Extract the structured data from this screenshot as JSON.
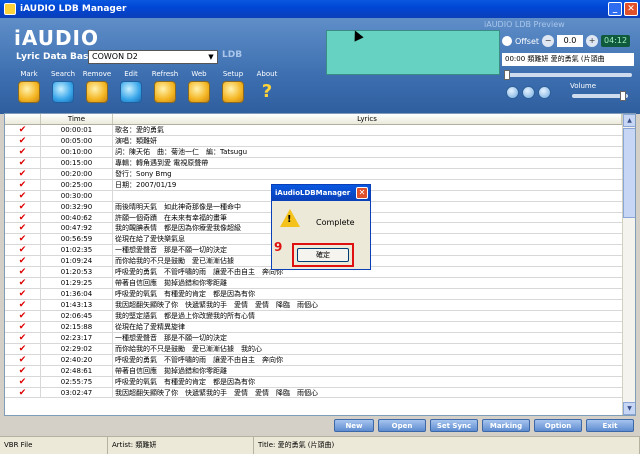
{
  "window": {
    "title": "iAUDIO LDB Manager"
  },
  "brand": {
    "logo": "iAUDIO",
    "subtitle": "Lyric Data Base",
    "ldb_mark": "LDB"
  },
  "device": {
    "selected": "COWON D2"
  },
  "toolbar": [
    {
      "label": "Mark",
      "icon": "mark-icon"
    },
    {
      "label": "Search",
      "icon": "search-icon"
    },
    {
      "label": "Remove",
      "icon": "remove-icon"
    },
    {
      "label": "Edit",
      "icon": "edit-icon"
    },
    {
      "label": "Refresh",
      "icon": "refresh-icon"
    },
    {
      "label": "Web",
      "icon": "web-icon"
    },
    {
      "label": "Setup",
      "icon": "setup-icon"
    },
    {
      "label": "About",
      "icon": "help-icon"
    }
  ],
  "preview": {
    "title": "iAUDIO LDB Preview",
    "offset_label": "Offset",
    "offset_value": "0.0",
    "time": "04:12",
    "song": "00:00 類難妍 愛的勇氣 (片頭曲"
  },
  "volume": {
    "label": "Volume"
  },
  "table": {
    "headers": [
      "",
      "Time",
      "Lyrics"
    ],
    "rows": [
      {
        "mark": "✔",
        "time": "00:00:01",
        "lyric": "歌名：愛的勇氣"
      },
      {
        "mark": "✔",
        "time": "00:05:00",
        "lyric": "演唱：類難妍"
      },
      {
        "mark": "✔",
        "time": "00:10:00",
        "lyric": "詞：陳天佑　曲：菊池一仁　編：Tatsugu"
      },
      {
        "mark": "✔",
        "time": "00:15:00",
        "lyric": "專輯：轉角遇到愛 電視原聲帶"
      },
      {
        "mark": "✔",
        "time": "00:20:00",
        "lyric": "發行：Sony Bmg"
      },
      {
        "mark": "✔",
        "time": "00:25:00",
        "lyric": "日期：2007/01/19"
      },
      {
        "mark": "✔",
        "time": "00:30:00",
        "lyric": ""
      },
      {
        "mark": "✔",
        "time": "00:32:90",
        "lyric": "雨後晴明天氣　如此神奇那像是一種命中"
      },
      {
        "mark": "✔",
        "time": "00:40:62",
        "lyric": "許願一個奇蹟　在未來有幸福的畫筆"
      },
      {
        "mark": "✔",
        "time": "00:47:92",
        "lyric": "我的靦腆表情　都是因為你療愛我像超級"
      },
      {
        "mark": "✔",
        "time": "00:56:59",
        "lyric": "從現在給了愛快樂氣息"
      },
      {
        "mark": "✔",
        "time": "01:02:35",
        "lyric": "一種想愛聲音　那是不願一切的決定"
      },
      {
        "mark": "✔",
        "time": "01:09:24",
        "lyric": "而你給我的不只是鼓勵　愛已漸漸佔據"
      },
      {
        "mark": "✔",
        "time": "01:20:53",
        "lyric": "呼吸愛的勇氣　不管呼嘯的雨　讓愛不由自主　奔向你"
      },
      {
        "mark": "✔",
        "time": "01:29:25",
        "lyric": "帶著自信回應　拋掉過錯和你零距離"
      },
      {
        "mark": "✔",
        "time": "01:36:04",
        "lyric": "呼吸愛的氧氣　有種愛的肯定　都是因為有你"
      },
      {
        "mark": "✔",
        "time": "01:43:13",
        "lyric": "我因超翻矢顯映了你　快遞緊我的手　愛情　愛情　降臨　雨個心"
      },
      {
        "mark": "✔",
        "time": "02:06:45",
        "lyric": "我的堅定語氣　都是過上你改變我的所有心情"
      },
      {
        "mark": "✔",
        "time": "02:15:88",
        "lyric": "從現在給了愛精異旋律"
      },
      {
        "mark": "✔",
        "time": "02:23:17",
        "lyric": "一種想愛聲音　那是不願一切的決定"
      },
      {
        "mark": "✔",
        "time": "02:29:02",
        "lyric": "而你給我的不只是鼓勵　愛已漸漸佔據　我的心"
      },
      {
        "mark": "✔",
        "time": "02:40:20",
        "lyric": "呼吸愛的勇氣　不管呼嘯的雨　讓愛不由自主　奔向你"
      },
      {
        "mark": "✔",
        "time": "02:48:61",
        "lyric": "帶著自信回應　拋掉過錯和你零距離"
      },
      {
        "mark": "✔",
        "time": "02:55:75",
        "lyric": "呼吸愛的氧氣　有種愛的肯定　都是因為有你"
      },
      {
        "mark": "✔",
        "time": "03:02:47",
        "lyric": "我因超翻矢顯映了你　快遞緊我的手　愛情　愛情　降臨　雨個心"
      }
    ]
  },
  "buttons": [
    "New",
    "Open",
    "Set Sync",
    "Marking",
    "Option",
    "Exit"
  ],
  "status": {
    "file": "VBR File",
    "artist": "Artist: 類難妍",
    "title": "Title: 愛的勇氣 (片頭曲)"
  },
  "dialog": {
    "title": "iAudioLDBManager",
    "message": "Complete",
    "ok": "確定",
    "annotation": "9"
  }
}
